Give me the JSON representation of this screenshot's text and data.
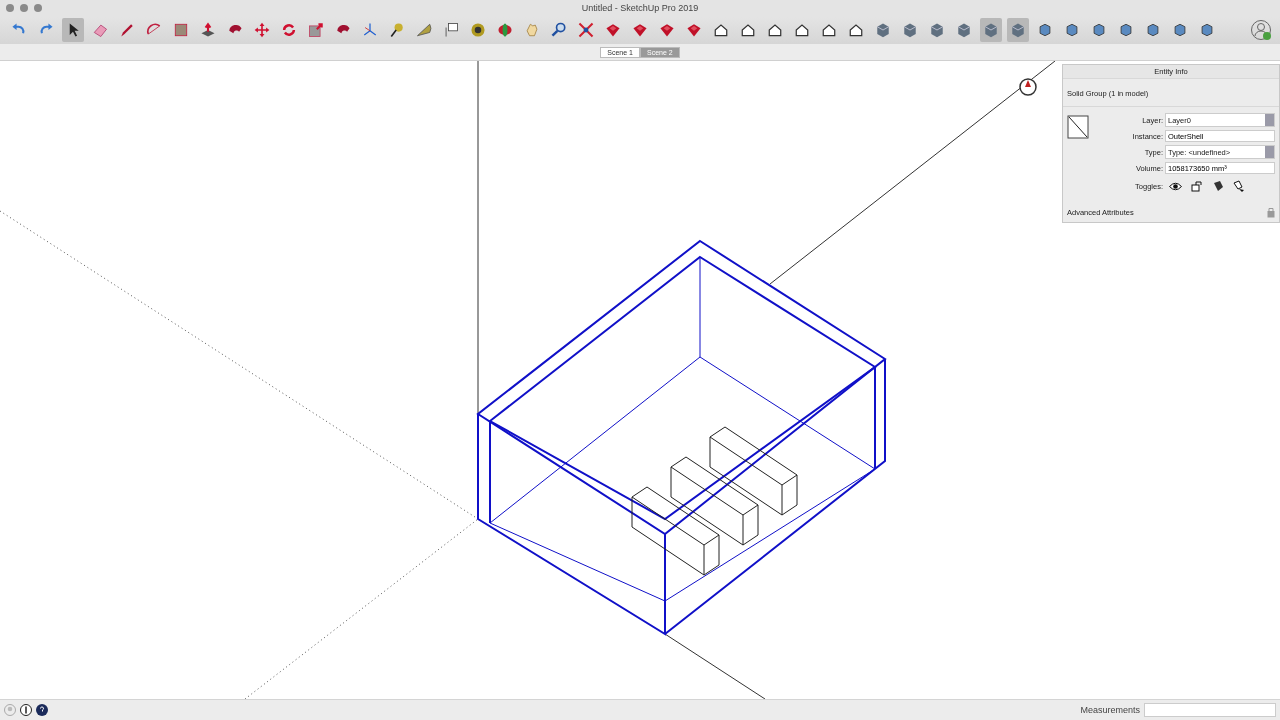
{
  "window": {
    "title": "Untitled - SketchUp Pro 2019"
  },
  "toolbar": [
    {
      "kind": "undo",
      "selected": false
    },
    {
      "kind": "redo",
      "selected": false
    },
    {
      "kind": "cursor",
      "selected": true
    },
    {
      "kind": "eraser",
      "selected": false
    },
    {
      "kind": "pencil",
      "selected": false
    },
    {
      "kind": "arc",
      "selected": false
    },
    {
      "kind": "rectangle",
      "selected": false
    },
    {
      "kind": "push",
      "selected": false
    },
    {
      "kind": "swirl",
      "selected": false
    },
    {
      "kind": "move",
      "selected": false
    },
    {
      "kind": "rotate",
      "selected": false
    },
    {
      "kind": "scale",
      "selected": false
    },
    {
      "kind": "swirl",
      "selected": false
    },
    {
      "kind": "axes",
      "selected": false
    },
    {
      "kind": "pen",
      "selected": false
    },
    {
      "kind": "protractor",
      "selected": false
    },
    {
      "kind": "label",
      "selected": false
    },
    {
      "kind": "bucket",
      "selected": false
    },
    {
      "kind": "orbit",
      "selected": false
    },
    {
      "kind": "hand",
      "selected": false
    },
    {
      "kind": "zoom",
      "selected": false
    },
    {
      "kind": "extents",
      "selected": false
    },
    {
      "kind": "gem",
      "selected": false
    },
    {
      "kind": "gem",
      "selected": false
    },
    {
      "kind": "gem",
      "selected": false
    },
    {
      "kind": "gem",
      "selected": false
    },
    {
      "kind": "house",
      "selected": false
    },
    {
      "kind": "house",
      "selected": false
    },
    {
      "kind": "house",
      "selected": false
    },
    {
      "kind": "house",
      "selected": false
    },
    {
      "kind": "house",
      "selected": false
    },
    {
      "kind": "house",
      "selected": false
    },
    {
      "kind": "cube",
      "selected": false
    },
    {
      "kind": "cube",
      "selected": false
    },
    {
      "kind": "cube",
      "selected": false
    },
    {
      "kind": "cube",
      "selected": false
    },
    {
      "kind": "cube",
      "selected": true
    },
    {
      "kind": "cube",
      "selected": true
    },
    {
      "kind": "block",
      "selected": false
    },
    {
      "kind": "block",
      "selected": false
    },
    {
      "kind": "block",
      "selected": false
    },
    {
      "kind": "block",
      "selected": false
    },
    {
      "kind": "block",
      "selected": false
    },
    {
      "kind": "block",
      "selected": false
    },
    {
      "kind": "block",
      "selected": false
    }
  ],
  "scenes": [
    {
      "label": "Scene 1",
      "selected": false
    },
    {
      "label": "Scene 2",
      "selected": true
    }
  ],
  "entity_info": {
    "title": "Entity Info",
    "heading": "Solid Group (1 in model)",
    "fields": [
      {
        "kind": "select",
        "label": "Layer:",
        "value": "Layer0"
      },
      {
        "kind": "text",
        "label": "Instance:",
        "value": "OuterShell"
      },
      {
        "kind": "select",
        "label": "Type:",
        "value": "Type: <undefined>"
      },
      {
        "kind": "text",
        "label": "Volume:",
        "value": "1058173650 mm³"
      }
    ],
    "toggles_label": "Toggles:",
    "advanced": "Advanced Attributes"
  },
  "status_bar": {
    "measurements_label": "Measurements"
  }
}
